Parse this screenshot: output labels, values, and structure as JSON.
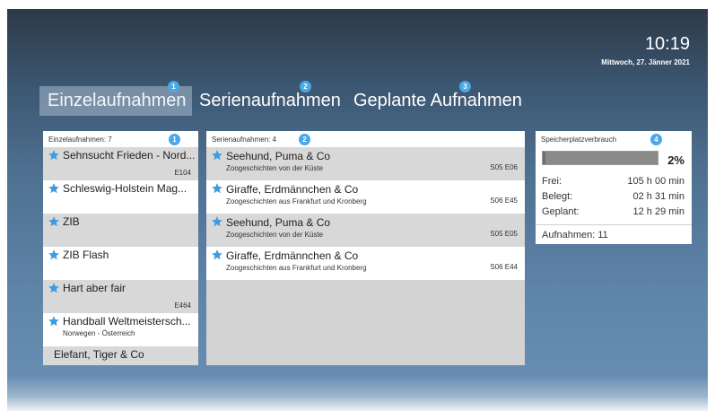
{
  "header": {
    "time": "10:19",
    "date": "Mittwoch, 27. Jänner 2021"
  },
  "tabs": [
    {
      "label": "Einzelaufnahmen",
      "badge": "1",
      "active": true
    },
    {
      "label": "Serienaufnahmen",
      "badge": "2",
      "active": false
    },
    {
      "label": "Geplante Aufnahmen",
      "badge": "3",
      "active": false
    }
  ],
  "single": {
    "header": "Einzelaufnahmen: 7",
    "badge": "1",
    "items": [
      {
        "title": "Sehnsucht Frieden - Nord...",
        "sub": "",
        "episode": "E104"
      },
      {
        "title": "Schleswig-Holstein Mag...",
        "sub": "",
        "episode": ""
      },
      {
        "title": "ZIB",
        "sub": "",
        "episode": ""
      },
      {
        "title": "ZIB Flash",
        "sub": "",
        "episode": ""
      },
      {
        "title": "Hart aber fair",
        "sub": "",
        "episode": "E464"
      },
      {
        "title": "Handball Weltmeistersch...",
        "sub": "Norwegen - Österreich",
        "episode": ""
      },
      {
        "title": "Elefant, Tiger & Co",
        "sub": "",
        "episode": ""
      }
    ]
  },
  "series": {
    "header": "Serienaufnahmen: 4",
    "badge": "2",
    "items": [
      {
        "title": "Seehund, Puma & Co",
        "sub": "Zoogeschichten von der Küste",
        "episode": "S05 E06"
      },
      {
        "title": "Giraffe, Erdmännchen & Co",
        "sub": "Zoogeschichten aus Frankfurt und Kronberg",
        "episode": "S06 E45"
      },
      {
        "title": "Seehund, Puma & Co",
        "sub": "Zoogeschichten von der Küste",
        "episode": "S05 E05"
      },
      {
        "title": "Giraffe, Erdmännchen & Co",
        "sub": "Zoogeschichten aus Frankfurt und Kronberg",
        "episode": "S06 E44"
      }
    ]
  },
  "storage": {
    "header": "Speicherplatzverbrauch",
    "badge": "4",
    "percent": "2%",
    "fill_fraction": 0.02,
    "stats": [
      {
        "label": "Frei:",
        "value": "105 h 00 min"
      },
      {
        "label": "Belegt:",
        "value": "02 h 31 min"
      },
      {
        "label": "Geplant:",
        "value": "12 h 29 min"
      }
    ],
    "recordings": "Aufnahmen: 11"
  },
  "colors": {
    "accent_badge": "#4aa8e8",
    "star": "#3d9be0"
  }
}
